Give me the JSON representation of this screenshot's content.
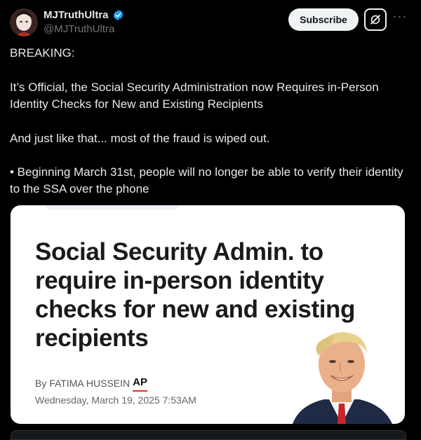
{
  "author": {
    "name": "MJTruthUltra",
    "handle": "@MJTruthUltra"
  },
  "actions": {
    "subscribe_label": "Subscribe",
    "more_label": "···"
  },
  "post": {
    "line1": "BREAKING:",
    "line2": "It’s Official, the Social Security Administration now Requires in-Person Identity Checks for New and Existing Recipients",
    "line3": "And just like that... most of the fraud is wiped out.",
    "line4": "• Beginning March 31st, people will no longer be able to verify their identity to the SSA over the phone"
  },
  "article": {
    "headline": "Social Security Admin. to require in-person identity checks for new and existing recipients",
    "byline": "By FATIMA HUSSEIN",
    "source": "AP",
    "date": "Wednesday, March 19, 2025 7:53AM"
  },
  "colors": {
    "background": "#000000",
    "text": "#e7e9ea",
    "verified": "#1d9bf0",
    "ap_red": "#e4312b"
  }
}
